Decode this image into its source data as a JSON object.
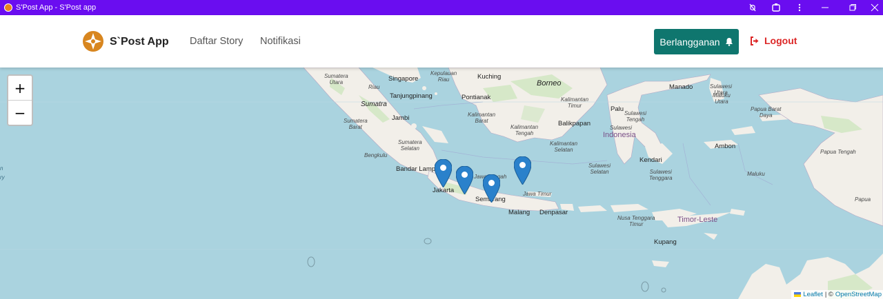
{
  "window": {
    "title": "S'Post App - S'Post app"
  },
  "header": {
    "brand": "S`Post App",
    "nav": [
      {
        "label": "Daftar Story"
      },
      {
        "label": "Notifikasi"
      }
    ],
    "subscribe_label": "Berlangganan",
    "logout_label": "Logout",
    "accent_color": "#0f766e",
    "logout_color": "#dc2626"
  },
  "map": {
    "zoom_in": "+",
    "zoom_out": "−",
    "attribution": {
      "leaflet": "Leaflet",
      "separator": "| ©",
      "osm": "OpenStreetMap"
    },
    "labels": {
      "singapore": "Singapore",
      "tanjungpinang": "Tanjungpinang",
      "kuching": "Kuching",
      "borneo": "Borneo",
      "pontianak": "Pontianak",
      "sumatra": "Sumatra",
      "jambi": "Jambi",
      "bandar_lampung": "Bandar Lampung",
      "jakarta": "Jakarta",
      "semarang": "Semarang",
      "malang": "Malang",
      "denpasar": "Denpasar",
      "balikpapan": "Balikpapan",
      "palu": "Palu",
      "manado": "Manado",
      "indonesia": "Indonesia",
      "kendari": "Kendari",
      "ambon": "Ambon",
      "kupang": "Kupang",
      "timor_leste": "Timor-Leste",
      "sumatera_utara": "Sumatera\nUtara",
      "riau": "Riau",
      "kepulauan_riau": "Kepulauan\nRiau",
      "sumatera_barat": "Sumatera\nBarat",
      "sumatera_selatan": "Sumatera\nSelatan",
      "bengkulu": "Bengkulu",
      "kalimantan_barat": "Kalimantan\nBarat",
      "kalimantan_tengah": "Kalimantan\nTengah",
      "kalimantan_timur": "Kalimantan\nTimur",
      "kalimantan_selatan": "Kalimantan\nSelatan",
      "sulawesi_tengah": "Sulawesi\nTengah",
      "sulawesi_selatan": "Sulawesi\nSelatan",
      "sulawesi_tenggara": "Sulawesi\nTenggara",
      "sulawesi_utara": "Sulawesi\nUtara",
      "gorontalo": "Gorontalo",
      "maluku_utara": "Maluku\nUtara",
      "maluku": "Maluku",
      "papua_barat_daya": "Papua Barat\nDaya",
      "papua_tengah": "Papua Tengah",
      "papua": "Papua",
      "jawa_tengah": "Jawa Tengah",
      "jawa_timur": "Jawa Timur",
      "nusa_tenggara_timur": "Nusa Tenggara\nTimur",
      "sulawesi": "Sulawesi",
      "left_edge_1": "n",
      "left_edge_2": "ry"
    },
    "markers": [
      {
        "name": "marker-1"
      },
      {
        "name": "marker-2"
      },
      {
        "name": "marker-3"
      },
      {
        "name": "marker-4"
      }
    ],
    "marker_color": "#2a81cb"
  }
}
